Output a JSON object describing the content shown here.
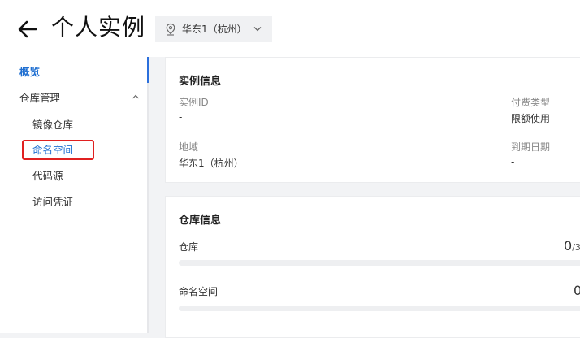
{
  "header": {
    "title": "个人实例",
    "region": "华东1（杭州）"
  },
  "sidebar": {
    "overview": "概览",
    "repo_management": "仓库管理",
    "items": [
      {
        "label": "镜像仓库"
      },
      {
        "label": "命名空间"
      },
      {
        "label": "代码源"
      },
      {
        "label": "访问凭证"
      }
    ]
  },
  "instance_card": {
    "title": "实例信息",
    "fields": [
      {
        "label": "实例ID",
        "value": "-"
      },
      {
        "label": "付费类型",
        "value": "限额使用"
      },
      {
        "label": "地域",
        "value": "华东1（杭州）"
      },
      {
        "label": "到期日期",
        "value": "-"
      }
    ]
  },
  "repo_card": {
    "title": "仓库信息",
    "repos_label": "仓库",
    "repos_count": "0",
    "repos_limit": "/3",
    "namespace_label": "命名空间",
    "namespace_count": "0"
  },
  "colors": {
    "accent": "#1f6fd1",
    "highlight": "#e02020"
  }
}
